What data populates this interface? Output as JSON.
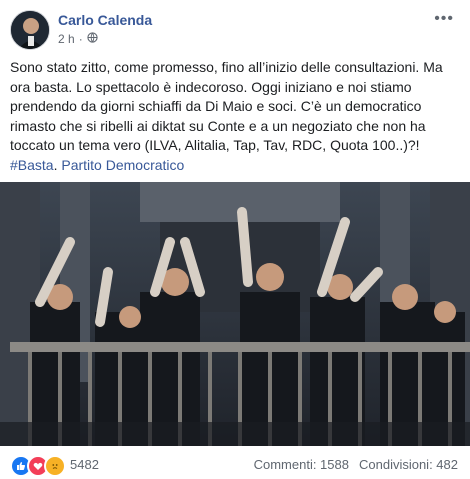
{
  "post": {
    "author": "Carlo Calenda",
    "time": "2 h",
    "text_paragraphs": [
      "Sono stato zitto, come promesso, fino all’inizio delle consultazioni. Ma ora basta. Lo spettacolo è indecoroso. Oggi iniziano e noi stiamo prendendo da giorni schiaffi da Di Maio e soci. C’è un democratico rimasto che si ribelli ai diktat su Conte e a un negoziato che non ha toccato un tema vero (ILVA, Alitalia, Tap, Tav, RDC, Quota 100..)?!"
    ],
    "hashtag": "#Basta",
    "separator": ". ",
    "page_link": "Partito Democratico"
  },
  "footer": {
    "reaction_count": "5482",
    "comments": "Commenti: 1588",
    "shares": "Condivisioni: 482"
  },
  "icons": {
    "privacy": "globe-icon",
    "more": "more-options-icon",
    "reactions": [
      "like-icon",
      "love-icon",
      "sad-icon"
    ]
  },
  "colors": {
    "link": "#385898",
    "like": "#1877f2",
    "love": "#f33e58",
    "sad": "#f7b125"
  }
}
